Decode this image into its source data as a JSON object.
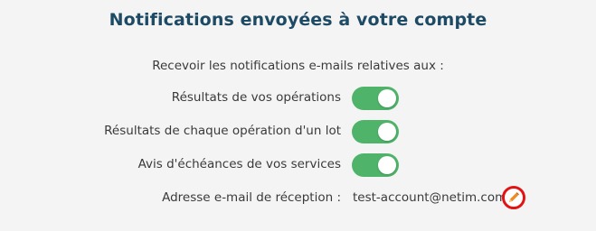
{
  "title": "Notifications envoyées à votre compte",
  "intro": "Recevoir les notifications e-mails relatives aux :",
  "settings": [
    {
      "label": "Résultats de vos opérations",
      "enabled": true
    },
    {
      "label": "Résultats de chaque opération d'un lot",
      "enabled": true
    },
    {
      "label": "Avis d'échéances de vos services",
      "enabled": true
    }
  ],
  "email": {
    "label": "Adresse e-mail de réception :",
    "value": "test-account@netim.com",
    "edit_icon": "pencil-icon"
  },
  "colors": {
    "title": "#1d4a64",
    "toggle_on": "#4fb46a",
    "highlight_ring": "#e01414",
    "pencil": "#f08a24"
  }
}
